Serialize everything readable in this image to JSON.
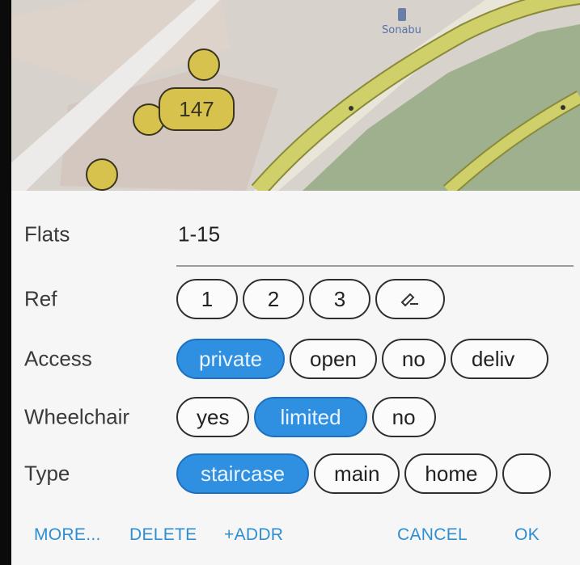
{
  "map": {
    "house_number": "147",
    "poi_label": "Sonabu"
  },
  "form": {
    "flats": {
      "label": "Flats",
      "value": "1-15"
    },
    "ref": {
      "label": "Ref",
      "options": [
        "1",
        "2",
        "3"
      ],
      "edit_icon": "edit-pencil-icon"
    },
    "access": {
      "label": "Access",
      "options": [
        "private",
        "open",
        "no",
        "deliv"
      ],
      "selected": "private"
    },
    "wheelchair": {
      "label": "Wheelchair",
      "options": [
        "yes",
        "limited",
        "no"
      ],
      "selected": "limited"
    },
    "type": {
      "label": "Type",
      "options": [
        "staircase",
        "main",
        "home",
        ""
      ],
      "selected": "staircase"
    }
  },
  "actions": {
    "more": "MORE...",
    "delete": "DELETE",
    "add_addr": "+ADDR",
    "cancel": "CANCEL",
    "ok": "OK"
  },
  "colors": {
    "accent": "#2f8fe0",
    "action_text": "#2f8ed0",
    "sheet_bg": "#f6f6f6"
  }
}
